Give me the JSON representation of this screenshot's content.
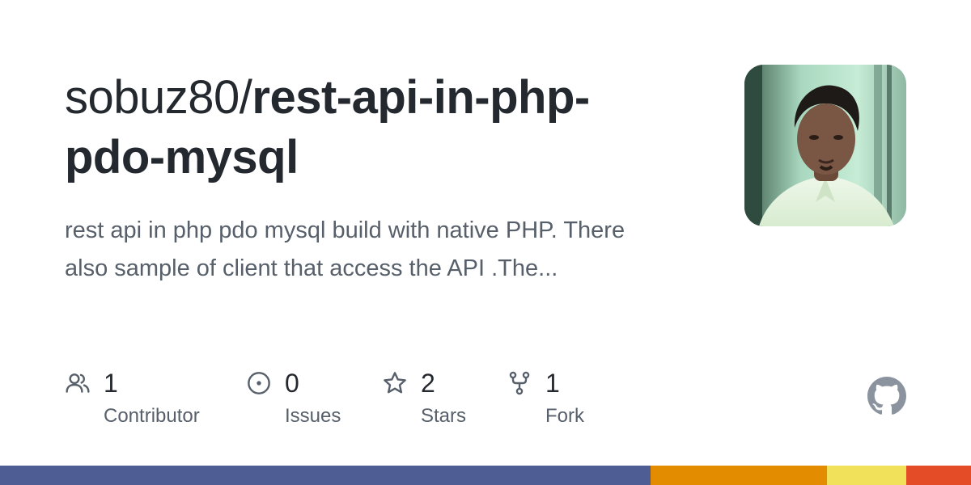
{
  "repo": {
    "owner": "sobuz80/",
    "name": "rest-api-in-php-pdo-mysql",
    "description": "rest api in php pdo mysql build with native PHP. There also sample of client that access the API .The..."
  },
  "stats": {
    "contributors": {
      "count": "1",
      "label": "Contributor",
      "icon": "people-icon"
    },
    "issues": {
      "count": "0",
      "label": "Issues",
      "icon": "issue-opened-icon"
    },
    "stars": {
      "count": "2",
      "label": "Stars",
      "icon": "star-icon"
    },
    "forks": {
      "count": "1",
      "label": "Fork",
      "icon": "repo-forked-icon"
    }
  },
  "language_bar": [
    {
      "color": "#4F5D95",
      "fraction": 0.67
    },
    {
      "color": "#E38C00",
      "fraction": 0.1817
    },
    {
      "color": "#F1E05A",
      "fraction": 0.0817
    },
    {
      "color": "#E34C26",
      "fraction": 0.0666
    }
  ],
  "colors": {
    "title": "#24292f",
    "muted": "#57606a",
    "github_logo": "#8b949e"
  }
}
